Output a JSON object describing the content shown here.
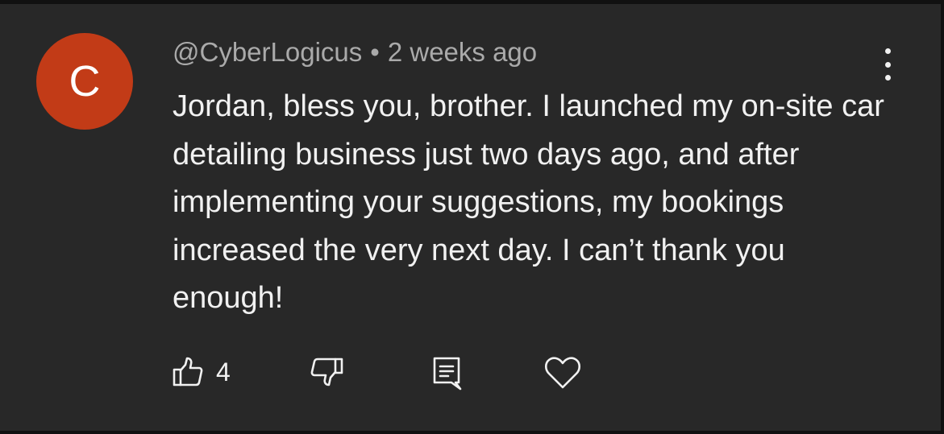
{
  "comment": {
    "avatar_initial": "C",
    "avatar_color": "#c23b17",
    "username": "@CyberLogicus",
    "separator": "•",
    "timestamp": "2 weeks ago",
    "text": "Jordan, bless you, brother. I launched my on-site car detailing business just two days ago, and after implementing your suggestions, my bookings increased the very next day. I can’t thank you enough!",
    "like_count": "4"
  },
  "actions": {
    "like_icon": "thumbs-up-icon",
    "dislike_icon": "thumbs-down-icon",
    "reply_icon": "reply-comment-icon",
    "heart_icon": "heart-icon",
    "more_icon": "more-vertical-icon"
  },
  "colors": {
    "background": "#282828",
    "text_primary": "#f1f1f1",
    "text_secondary": "#aaaaaa"
  }
}
